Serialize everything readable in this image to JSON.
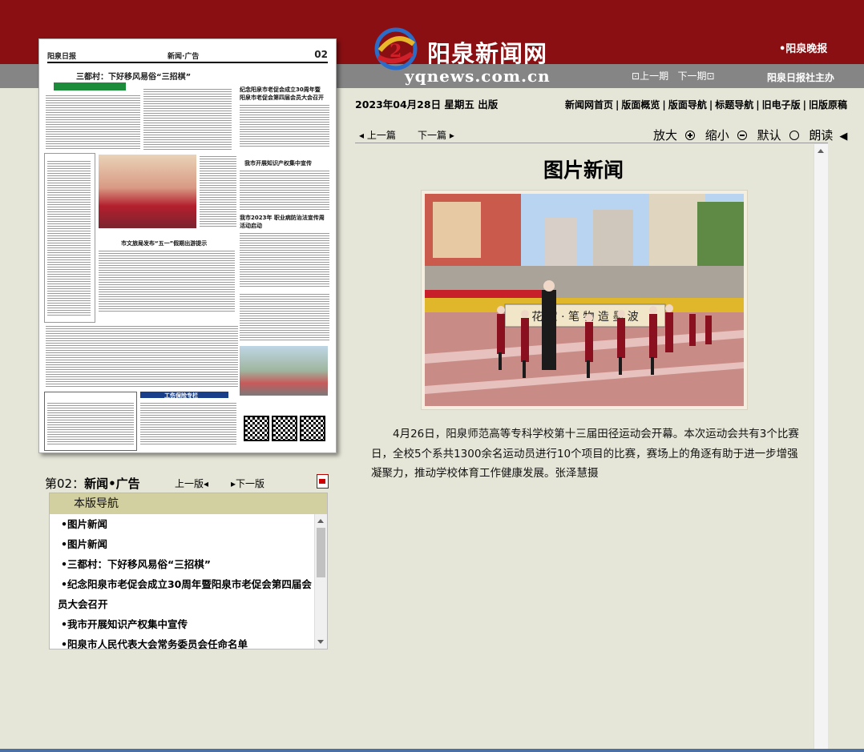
{
  "header": {
    "site_name": "阳泉新闻网",
    "site_url": "yqnews.com.cn",
    "evening_paper": "•阳泉晚报",
    "prev_issue": "上一期",
    "next_issue": "下一期",
    "sponsor": "阳泉日报社主办",
    "date_line": "2023年04月28日 星期五 出版",
    "nav": [
      "新闻网首页",
      "版面概览",
      "版面导航",
      "标题导航",
      "旧电子版",
      "旧版原稿"
    ]
  },
  "paper_thumb": {
    "logo": "阳泉日报",
    "section": "新闻·广告",
    "page_no": "02",
    "headline": "三都村：下好移风易俗“三招棋”",
    "heading_mid_1": "纪念阳泉市老促会成立30周年暨",
    "heading_mid_2": "阳泉市老促会第四届会员大会召开",
    "heading_ip": "我市开展知识产权集中宣传",
    "heading_vaccine": "我市2023年 职业病防治法宣传周活动启动",
    "heading_tourism": "市文旅局发布“五一”假期出游提示",
    "heading_insurance": "工伤保险专栏"
  },
  "page_label": {
    "prefix": "第02：",
    "name": "新闻•广告",
    "prev": "上一版",
    "next": "下一版"
  },
  "nav_panel": {
    "title": "本版导航",
    "items": [
      "•图片新闻",
      "•图片新闻",
      "•三都村：下好移风易俗“三招棋”",
      "•纪念阳泉市老促会成立30周年暨阳泉市老促会第四届会员大会召开",
      "•我市开展知识产权集中宣传",
      "•阳泉市人民代表大会常务委员会任命名单"
    ]
  },
  "article": {
    "prev": "上一篇",
    "next": "下一篇",
    "zoom_in": "放大",
    "zoom_out": "缩小",
    "default": "默认",
    "read_aloud": "朗读",
    "title": "图片新闻",
    "banner_text": "花 宝 · 笔 物 造 墨 波",
    "caption": "4月26日，阳泉师范高等专科学校第十三届田径运动会开幕。本次运动会共有3个比赛日，全校5个系共1300余名运动员进行10个项目的比赛，赛场上的角逐有助于进一步增强凝聚力，推动学校体育工作健康发展。张泽慧摄"
  },
  "colors": {
    "brand_red": "#8a0f12",
    "grey_band": "#858585",
    "page_bg": "#e6e6d8",
    "nav_head": "#d2cfa1"
  }
}
